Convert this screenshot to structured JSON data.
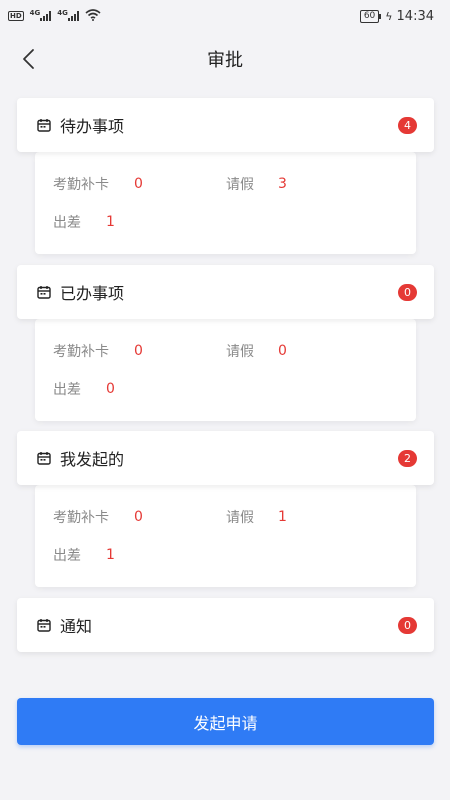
{
  "status_bar": {
    "hd": "HD",
    "net1": "4G",
    "net2": "4G",
    "battery": "60",
    "time": "14:34"
  },
  "nav": {
    "back_icon": "chevron-left-icon",
    "title": "审批"
  },
  "sections": [
    {
      "title": "待办事项",
      "badge": "4",
      "stats": {
        "attendance_label": "考勤补卡",
        "attendance_value": "0",
        "leave_label": "请假",
        "leave_value": "3",
        "trip_label": "出差",
        "trip_value": "1"
      }
    },
    {
      "title": "已办事项",
      "badge": "0",
      "stats": {
        "attendance_label": "考勤补卡",
        "attendance_value": "0",
        "leave_label": "请假",
        "leave_value": "0",
        "trip_label": "出差",
        "trip_value": "0"
      }
    },
    {
      "title": "我发起的",
      "badge": "2",
      "stats": {
        "attendance_label": "考勤补卡",
        "attendance_value": "0",
        "leave_label": "请假",
        "leave_value": "1",
        "trip_label": "出差",
        "trip_value": "1"
      }
    },
    {
      "title": "通知",
      "badge": "0"
    }
  ],
  "submit_button": "发起申请",
  "colors": {
    "accent": "#2f7bf5",
    "badge": "#e53935",
    "background": "#f3f3f6"
  }
}
